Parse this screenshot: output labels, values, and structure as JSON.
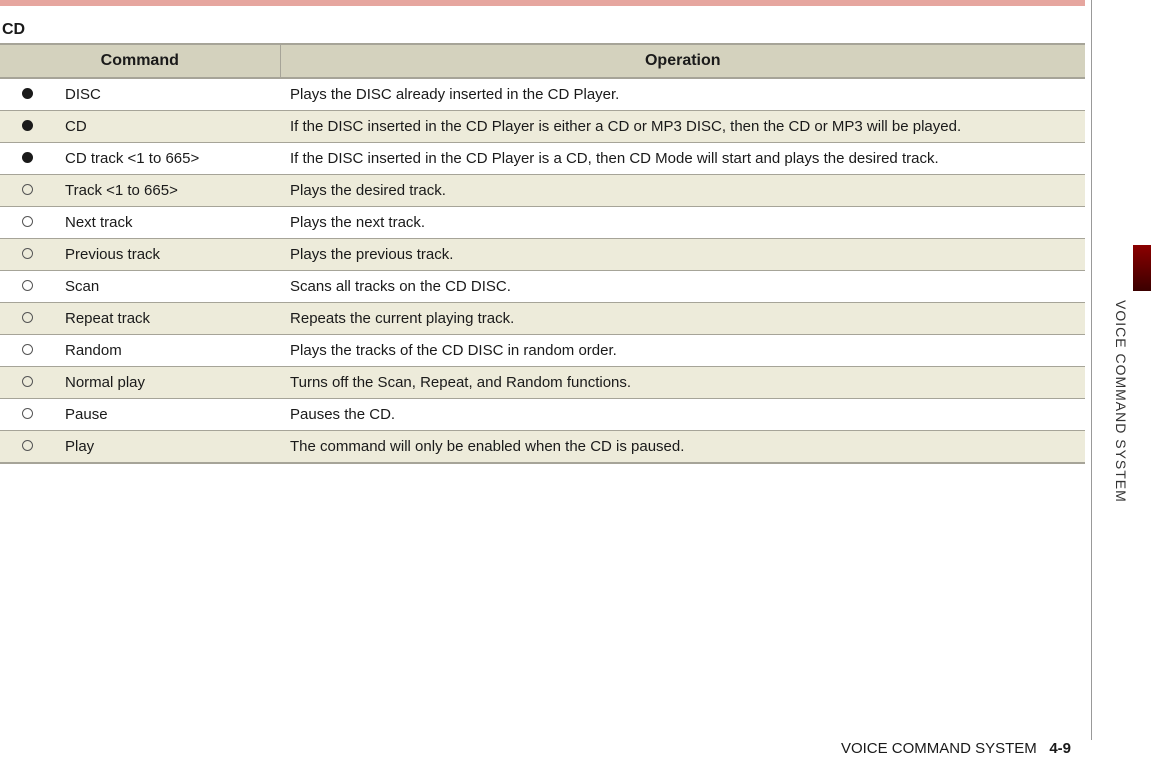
{
  "section_title": "CD",
  "columns": {
    "command": "Command",
    "operation": "Operation"
  },
  "rows": [
    {
      "filled": true,
      "command": "DISC",
      "operation": "Plays the DISC already inserted in the CD Player."
    },
    {
      "filled": true,
      "command": "CD",
      "operation": "If the DISC inserted in the CD Player is either a CD or MP3 DISC, then the CD or MP3 will be played."
    },
    {
      "filled": true,
      "command": "CD track <1 to 665>",
      "operation": "If the DISC inserted in the CD Player is a CD, then CD Mode will start and plays the desired track."
    },
    {
      "filled": false,
      "command": "Track <1 to 665>",
      "operation": "Plays the desired track."
    },
    {
      "filled": false,
      "command": "Next track",
      "operation": "Plays the next track."
    },
    {
      "filled": false,
      "command": "Previous track",
      "operation": "Plays the previous track."
    },
    {
      "filled": false,
      "command": "Scan",
      "operation": "Scans all tracks on the CD DISC."
    },
    {
      "filled": false,
      "command": "Repeat track",
      "operation": "Repeats the current playing track."
    },
    {
      "filled": false,
      "command": "Random",
      "operation": "Plays the tracks of the CD DISC in random order."
    },
    {
      "filled": false,
      "command": "Normal play",
      "operation": "Turns off the Scan, Repeat, and Random functions."
    },
    {
      "filled": false,
      "command": "Pause",
      "operation": "Pauses the CD."
    },
    {
      "filled": false,
      "command": "Play",
      "operation": "The command will only be enabled when the CD is paused."
    }
  ],
  "side_label": "VOICE COMMAND SYSTEM",
  "footer": {
    "label": "VOICE COMMAND SYSTEM",
    "page": "4-9"
  }
}
